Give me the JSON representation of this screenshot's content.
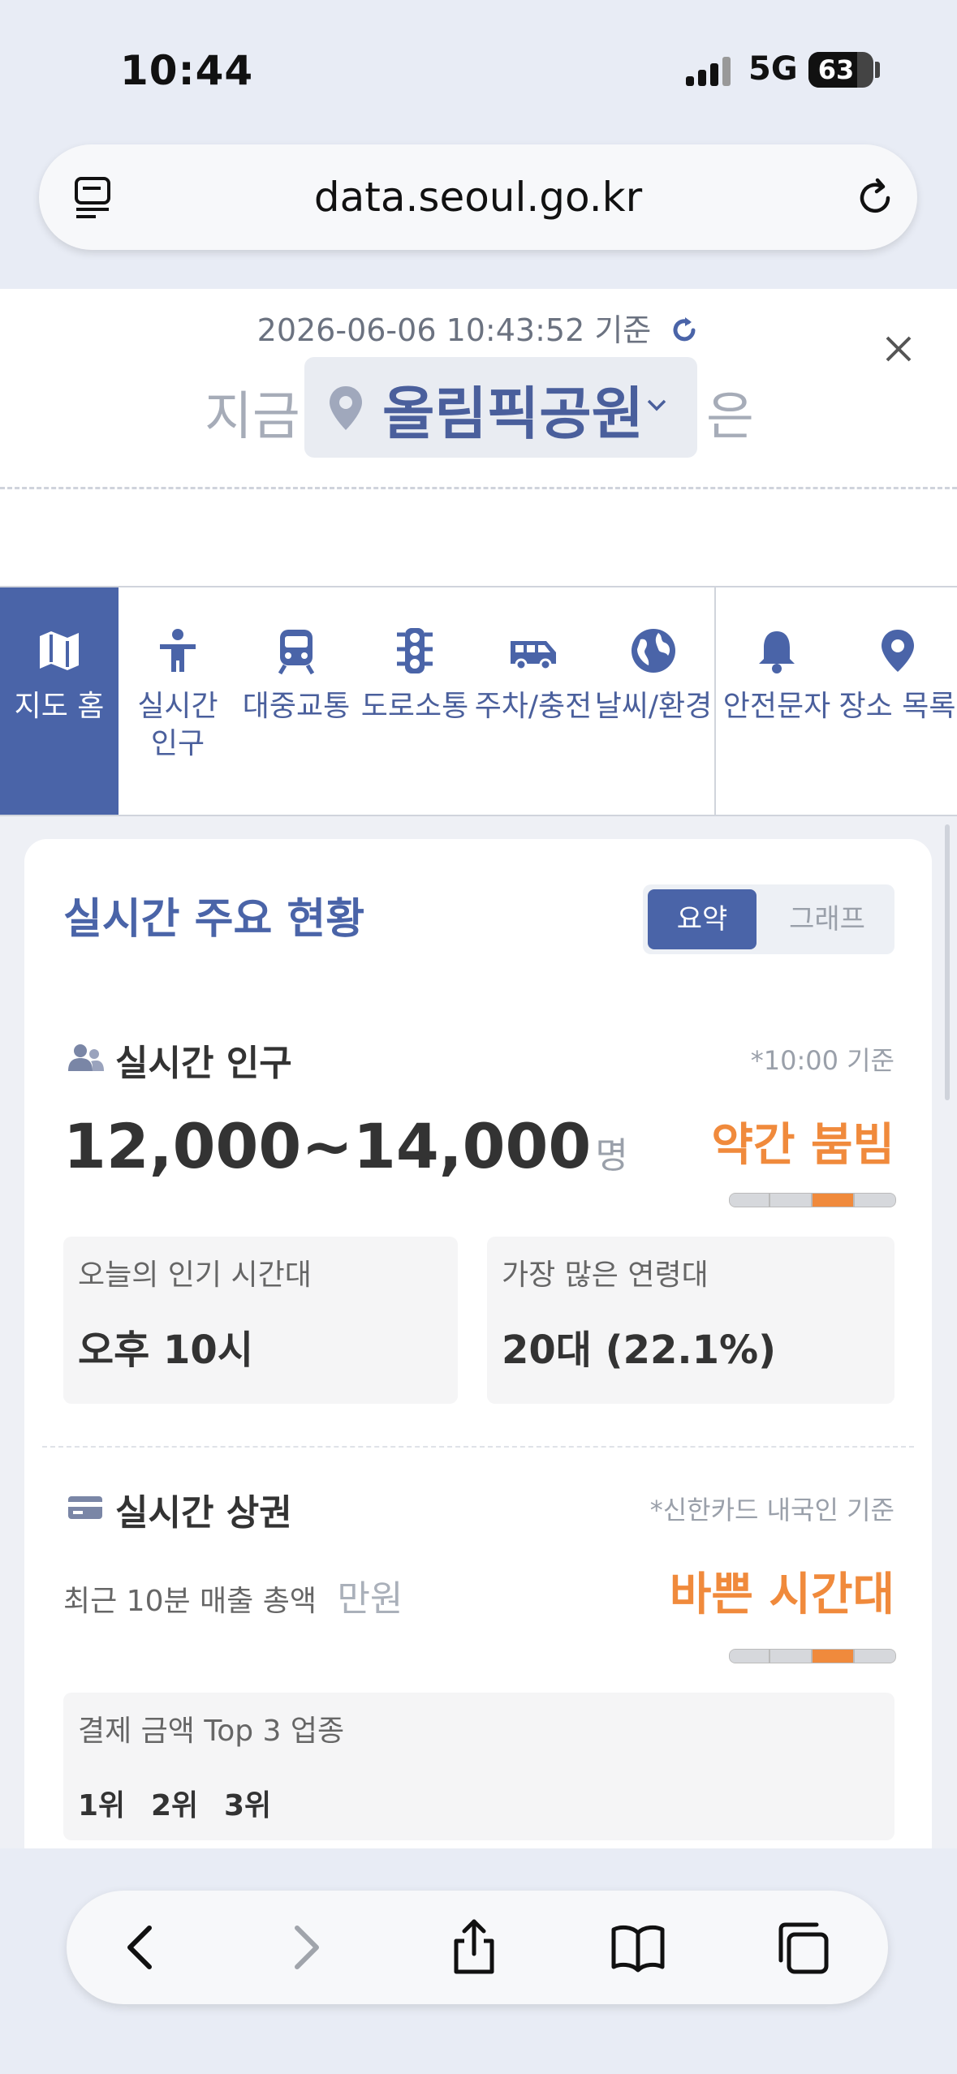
{
  "status_bar": {
    "time": "10:44",
    "network": "5G",
    "battery": "63"
  },
  "browser": {
    "url": "data.seoul.go.kr"
  },
  "header": {
    "timestamp": "2026-06-06 10:43:52 기준",
    "now_label": "지금",
    "location": "올림픽공원",
    "suffix": "은"
  },
  "nav": {
    "items": [
      {
        "label": "지도 홈",
        "icon": "map-icon"
      },
      {
        "label": "실시간\n인구",
        "icon": "person-icon"
      },
      {
        "label": "대중교통",
        "icon": "train-icon"
      },
      {
        "label": "도로소통",
        "icon": "traffic-light-icon"
      },
      {
        "label": "주차/충전",
        "icon": "van-icon"
      },
      {
        "label": "날씨/환경",
        "icon": "globe-icon"
      },
      {
        "label": "안전문자",
        "icon": "bell-icon"
      },
      {
        "label": "장소 목록",
        "icon": "pin-icon"
      }
    ]
  },
  "card": {
    "title": "실시간 주요 현황",
    "toggle": {
      "summary": "요약",
      "graph": "그래프"
    },
    "population": {
      "title": "실시간 인구",
      "note": "*10:00 기준",
      "value": "12,000~14,000",
      "unit": "명",
      "status": "약간 붐빔",
      "level": 3,
      "popular_time_label": "오늘의 인기 시간대",
      "popular_time_value": "오후 10시",
      "age_label": "가장 많은 연령대",
      "age_value": "20대 (22.1%)"
    },
    "commerce": {
      "title": "실시간 상권",
      "note": "*신한카드 내국인 기준",
      "sales_label": "최근 10분 매출 총액",
      "sales_unit": "만원",
      "status": "바쁜 시간대",
      "level": 3,
      "top3_title": "결제 금액 Top 3 업종",
      "ranks": [
        "1위",
        "2위",
        "3위"
      ]
    }
  },
  "colors": {
    "accent": "#4a64a8",
    "orange": "#f08a3c",
    "page_bg": "#eef0f5"
  }
}
